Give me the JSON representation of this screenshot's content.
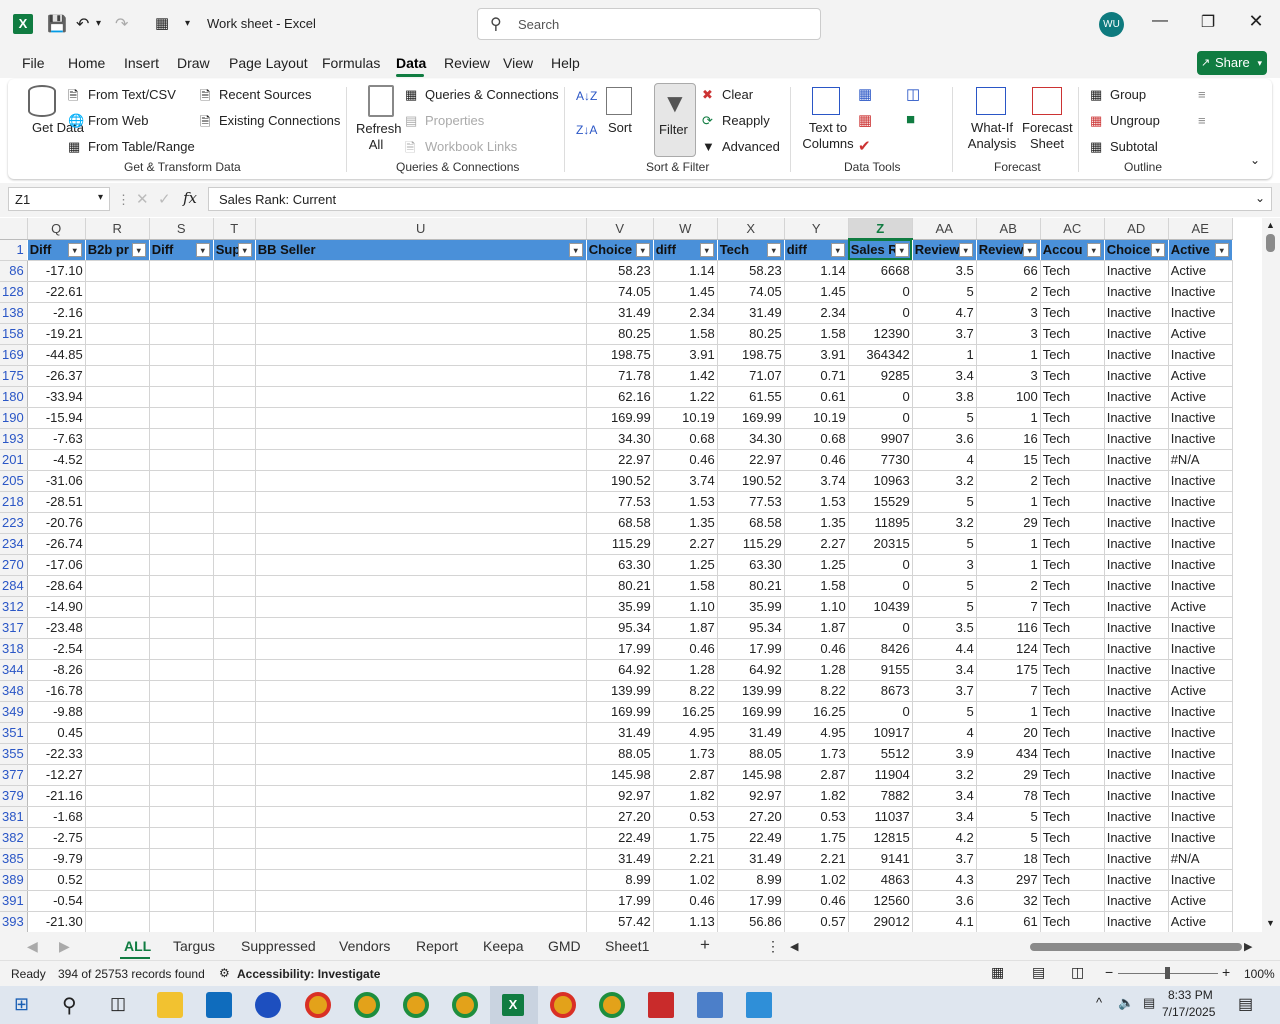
{
  "app": {
    "title": "Work sheet  -  Excel",
    "search_placeholder": "Search",
    "avatar": "WU",
    "share": "Share"
  },
  "menu": [
    "File",
    "Home",
    "Insert",
    "Draw",
    "Page Layout",
    "Formulas",
    "Data",
    "Review",
    "View",
    "Help"
  ],
  "ribbon": {
    "get_data": "Get Data",
    "from_text_csv": "From Text/CSV",
    "from_web": "From Web",
    "from_table_range": "From Table/Range",
    "recent_sources": "Recent Sources",
    "existing_connections": "Existing Connections",
    "group_get_transform": "Get & Transform Data",
    "refresh_all": "Refresh All",
    "queries_connections": "Queries & Connections",
    "properties": "Properties",
    "workbook_links": "Workbook Links",
    "group_queries": "Queries & Connections",
    "sort": "Sort",
    "filter": "Filter",
    "clear": "Clear",
    "reapply": "Reapply",
    "advanced": "Advanced",
    "group_sort_filter": "Sort & Filter",
    "text_to_columns": "Text to Columns",
    "group_data_tools": "Data Tools",
    "what_if": "What-If Analysis",
    "forecast_sheet": "Forecast Sheet",
    "group_forecast": "Forecast",
    "group": "Group",
    "ungroup": "Ungroup",
    "subtotal": "Subtotal",
    "group_outline": "Outline"
  },
  "formula_bar": {
    "name_box": "Z1",
    "fx": "fx",
    "content": "Sales Rank: Current"
  },
  "columns": [
    "Q",
    "R",
    "S",
    "T",
    "U",
    "V",
    "W",
    "X",
    "Y",
    "Z",
    "AA",
    "AB",
    "AC",
    "AD",
    "AE"
  ],
  "headers": [
    "Diff",
    "B2b pr",
    "Diff",
    "Sup",
    "BB Seller",
    "Choice",
    "diff",
    "Tech",
    "diff",
    "Sales R",
    "Review",
    "Review",
    "Accou",
    "Choice",
    "Active"
  ],
  "rows": [
    {
      "n": "86",
      "c": [
        "-17.10",
        "",
        "",
        "",
        "",
        "58.23",
        "1.14",
        "58.23",
        "1.14",
        "6668",
        "3.5",
        "66",
        "Tech",
        "Inactive",
        "Active"
      ]
    },
    {
      "n": "128",
      "c": [
        "-22.61",
        "",
        "",
        "",
        "",
        "74.05",
        "1.45",
        "74.05",
        "1.45",
        "0",
        "5",
        "2",
        "Tech",
        "Inactive",
        "Inactive"
      ]
    },
    {
      "n": "138",
      "c": [
        "-2.16",
        "",
        "",
        "",
        "",
        "31.49",
        "2.34",
        "31.49",
        "2.34",
        "0",
        "4.7",
        "3",
        "Tech",
        "Inactive",
        "Inactive"
      ]
    },
    {
      "n": "158",
      "c": [
        "-19.21",
        "",
        "",
        "",
        "",
        "80.25",
        "1.58",
        "80.25",
        "1.58",
        "12390",
        "3.7",
        "3",
        "Tech",
        "Inactive",
        "Active"
      ]
    },
    {
      "n": "169",
      "c": [
        "-44.85",
        "",
        "",
        "",
        "",
        "198.75",
        "3.91",
        "198.75",
        "3.91",
        "364342",
        "1",
        "1",
        "Tech",
        "Inactive",
        "Inactive"
      ]
    },
    {
      "n": "175",
      "c": [
        "-26.37",
        "",
        "",
        "",
        "",
        "71.78",
        "1.42",
        "71.07",
        "0.71",
        "9285",
        "3.4",
        "3",
        "Tech",
        "Inactive",
        "Active"
      ]
    },
    {
      "n": "180",
      "c": [
        "-33.94",
        "",
        "",
        "",
        "",
        "62.16",
        "1.22",
        "61.55",
        "0.61",
        "0",
        "3.8",
        "100",
        "Tech",
        "Inactive",
        "Active"
      ]
    },
    {
      "n": "190",
      "c": [
        "-15.94",
        "",
        "",
        "",
        "",
        "169.99",
        "10.19",
        "169.99",
        "10.19",
        "0",
        "5",
        "1",
        "Tech",
        "Inactive",
        "Inactive"
      ]
    },
    {
      "n": "193",
      "c": [
        "-7.63",
        "",
        "",
        "",
        "",
        "34.30",
        "0.68",
        "34.30",
        "0.68",
        "9907",
        "3.6",
        "16",
        "Tech",
        "Inactive",
        "Inactive"
      ]
    },
    {
      "n": "201",
      "c": [
        "-4.52",
        "",
        "",
        "",
        "",
        "22.97",
        "0.46",
        "22.97",
        "0.46",
        "7730",
        "4",
        "15",
        "Tech",
        "Inactive",
        "#N/A"
      ]
    },
    {
      "n": "205",
      "c": [
        "-31.06",
        "",
        "",
        "",
        "",
        "190.52",
        "3.74",
        "190.52",
        "3.74",
        "10963",
        "3.2",
        "2",
        "Tech",
        "Inactive",
        "Inactive"
      ]
    },
    {
      "n": "218",
      "c": [
        "-28.51",
        "",
        "",
        "",
        "",
        "77.53",
        "1.53",
        "77.53",
        "1.53",
        "15529",
        "5",
        "1",
        "Tech",
        "Inactive",
        "Inactive"
      ]
    },
    {
      "n": "223",
      "c": [
        "-20.76",
        "",
        "",
        "",
        "",
        "68.58",
        "1.35",
        "68.58",
        "1.35",
        "11895",
        "3.2",
        "29",
        "Tech",
        "Inactive",
        "Inactive"
      ]
    },
    {
      "n": "234",
      "c": [
        "-26.74",
        "",
        "",
        "",
        "",
        "115.29",
        "2.27",
        "115.29",
        "2.27",
        "20315",
        "5",
        "1",
        "Tech",
        "Inactive",
        "Inactive"
      ]
    },
    {
      "n": "270",
      "c": [
        "-17.06",
        "",
        "",
        "",
        "",
        "63.30",
        "1.25",
        "63.30",
        "1.25",
        "0",
        "3",
        "1",
        "Tech",
        "Inactive",
        "Inactive"
      ]
    },
    {
      "n": "284",
      "c": [
        "-28.64",
        "",
        "",
        "",
        "",
        "80.21",
        "1.58",
        "80.21",
        "1.58",
        "0",
        "5",
        "2",
        "Tech",
        "Inactive",
        "Inactive"
      ]
    },
    {
      "n": "312",
      "c": [
        "-14.90",
        "",
        "",
        "",
        "",
        "35.99",
        "1.10",
        "35.99",
        "1.10",
        "10439",
        "5",
        "7",
        "Tech",
        "Inactive",
        "Active"
      ]
    },
    {
      "n": "317",
      "c": [
        "-23.48",
        "",
        "",
        "",
        "",
        "95.34",
        "1.87",
        "95.34",
        "1.87",
        "0",
        "3.5",
        "116",
        "Tech",
        "Inactive",
        "Inactive"
      ]
    },
    {
      "n": "318",
      "c": [
        "-2.54",
        "",
        "",
        "",
        "",
        "17.99",
        "0.46",
        "17.99",
        "0.46",
        "8426",
        "4.4",
        "124",
        "Tech",
        "Inactive",
        "Inactive"
      ]
    },
    {
      "n": "344",
      "c": [
        "-8.26",
        "",
        "",
        "",
        "",
        "64.92",
        "1.28",
        "64.92",
        "1.28",
        "9155",
        "3.4",
        "175",
        "Tech",
        "Inactive",
        "Inactive"
      ]
    },
    {
      "n": "348",
      "c": [
        "-16.78",
        "",
        "",
        "",
        "",
        "139.99",
        "8.22",
        "139.99",
        "8.22",
        "8673",
        "3.7",
        "7",
        "Tech",
        "Inactive",
        "Active"
      ]
    },
    {
      "n": "349",
      "c": [
        "-9.88",
        "",
        "",
        "",
        "",
        "169.99",
        "16.25",
        "169.99",
        "16.25",
        "0",
        "5",
        "1",
        "Tech",
        "Inactive",
        "Inactive"
      ]
    },
    {
      "n": "351",
      "c": [
        "0.45",
        "",
        "",
        "",
        "",
        "31.49",
        "4.95",
        "31.49",
        "4.95",
        "10917",
        "4",
        "20",
        "Tech",
        "Inactive",
        "Inactive"
      ]
    },
    {
      "n": "355",
      "c": [
        "-22.33",
        "",
        "",
        "",
        "",
        "88.05",
        "1.73",
        "88.05",
        "1.73",
        "5512",
        "3.9",
        "434",
        "Tech",
        "Inactive",
        "Inactive"
      ]
    },
    {
      "n": "377",
      "c": [
        "-12.27",
        "",
        "",
        "",
        "",
        "145.98",
        "2.87",
        "145.98",
        "2.87",
        "11904",
        "3.2",
        "29",
        "Tech",
        "Inactive",
        "Inactive"
      ]
    },
    {
      "n": "379",
      "c": [
        "-21.16",
        "",
        "",
        "",
        "",
        "92.97",
        "1.82",
        "92.97",
        "1.82",
        "7882",
        "3.4",
        "78",
        "Tech",
        "Inactive",
        "Inactive"
      ]
    },
    {
      "n": "381",
      "c": [
        "-1.68",
        "",
        "",
        "",
        "",
        "27.20",
        "0.53",
        "27.20",
        "0.53",
        "11037",
        "3.4",
        "5",
        "Tech",
        "Inactive",
        "Inactive"
      ]
    },
    {
      "n": "382",
      "c": [
        "-2.75",
        "",
        "",
        "",
        "",
        "22.49",
        "1.75",
        "22.49",
        "1.75",
        "12815",
        "4.2",
        "5",
        "Tech",
        "Inactive",
        "Inactive"
      ]
    },
    {
      "n": "385",
      "c": [
        "-9.79",
        "",
        "",
        "",
        "",
        "31.49",
        "2.21",
        "31.49",
        "2.21",
        "9141",
        "3.7",
        "18",
        "Tech",
        "Inactive",
        "#N/A"
      ]
    },
    {
      "n": "389",
      "c": [
        "0.52",
        "",
        "",
        "",
        "",
        "8.99",
        "1.02",
        "8.99",
        "1.02",
        "4863",
        "4.3",
        "297",
        "Tech",
        "Inactive",
        "Inactive"
      ]
    },
    {
      "n": "391",
      "c": [
        "-0.54",
        "",
        "",
        "",
        "",
        "17.99",
        "0.46",
        "17.99",
        "0.46",
        "12560",
        "3.6",
        "32",
        "Tech",
        "Inactive",
        "Active"
      ]
    },
    {
      "n": "393",
      "c": [
        "-21.30",
        "",
        "",
        "",
        "",
        "57.42",
        "1.13",
        "56.86",
        "0.57",
        "29012",
        "4.1",
        "61",
        "Tech",
        "Inactive",
        "Active"
      ]
    }
  ],
  "sheets": [
    "ALL",
    "Targus",
    "Suppressed",
    "Vendors",
    "Report",
    "Keepa",
    "GMD",
    "Sheet1"
  ],
  "status": {
    "ready": "Ready",
    "records": "394 of 25753 records found",
    "accessibility": "Accessibility: Investigate",
    "zoom": "100%"
  },
  "taskbar": {
    "time": "8:33 PM",
    "date": "7/17/2025"
  },
  "colors": {
    "accent": "#107c41",
    "header_fill": "#4a90d9"
  }
}
